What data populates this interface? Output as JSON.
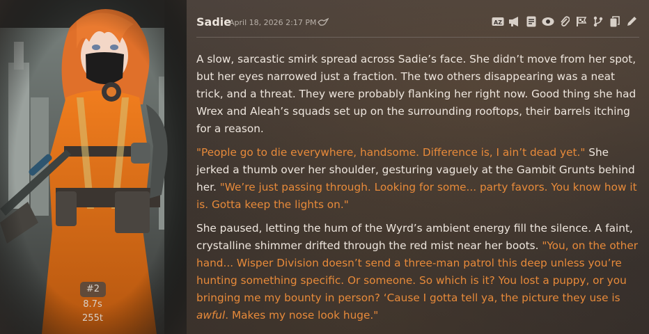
{
  "message": {
    "character_name": "Sadie",
    "timestamp": "April 18, 2026 2:17 PM",
    "mes_id": "#2",
    "gen_time": "8.7s",
    "tokens": "255t"
  },
  "toolbar_icons": [
    "translate-icon",
    "narrate-icon",
    "prompt-icon",
    "hide-icon",
    "attach-icon",
    "flag-icon",
    "branch-icon",
    "copy-icon",
    "edit-icon"
  ],
  "colors": {
    "quote": "#e78a3a",
    "text": "#eee6de",
    "accent": "#e07a2a"
  },
  "paragraphs": [
    {
      "parts": [
        {
          "t": "A slow, sarcastic smirk spread across Sadie’s face. She didn’t move from her spot, but her eyes narrowed just a fraction. The two others disappearing was a neat trick, and a threat. They were probably flanking her right now. Good thing she had Wrex and Aleah’s squads set up on the surrounding rooftops, their barrels itching for a reason.",
          "q": false
        }
      ]
    },
    {
      "parts": [
        {
          "t": "\"People go to die everywhere, handsome. Difference is, I ain’t dead yet.\"",
          "q": true
        },
        {
          "t": " She jerked a thumb over her shoulder, gesturing vaguely at the Gambit Grunts behind her. ",
          "q": false
        },
        {
          "t": "\"We’re just passing through. Looking for some... party favors. You know how it is. Gotta keep the lights on.\"",
          "q": true
        }
      ]
    },
    {
      "parts": [
        {
          "t": "She paused, letting the hum of the Wyrd’s ambient energy fill the silence. A faint, crystalline shimmer drifted through the red mist near her boots. ",
          "q": false
        },
        {
          "t": "\"You, on the other hand... Wisper Division doesn’t send a three-man patrol this deep unless you’re hunting something specific. Or someone. So which is it? You lost a puppy, or you bringing me my bounty in person? ‘Cause I gotta tell ya, the picture they use is ",
          "q": true
        },
        {
          "t": "awful",
          "q": true,
          "em": true
        },
        {
          "t": ". Makes my nose look huge.\"",
          "q": true
        }
      ]
    }
  ]
}
